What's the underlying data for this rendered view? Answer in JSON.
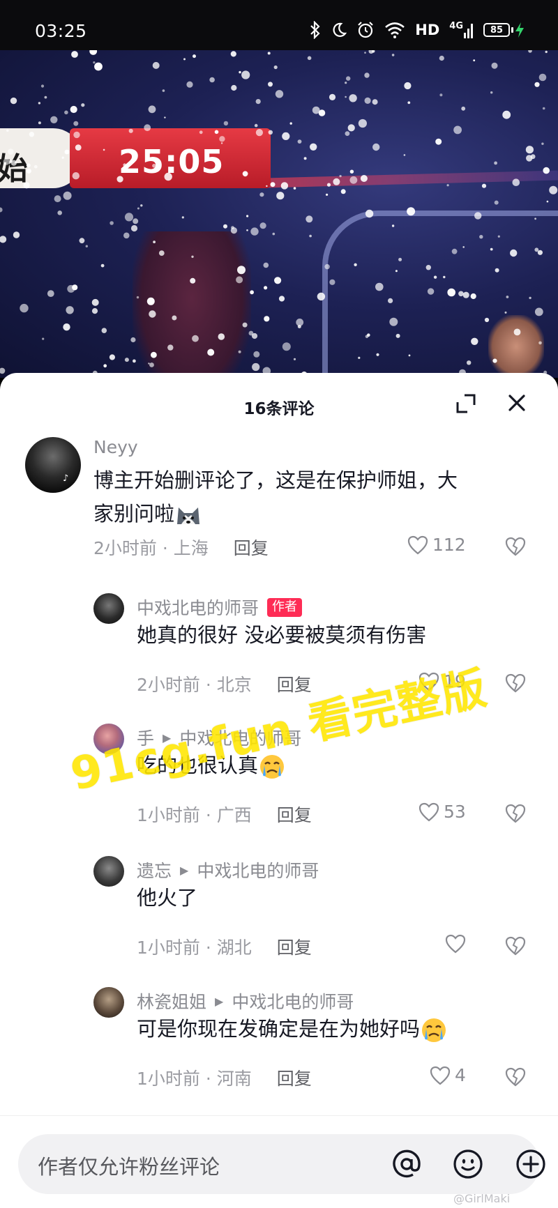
{
  "status_bar": {
    "time": "03:25",
    "hd": "HD",
    "network": "4G",
    "battery": "85",
    "icons": [
      "bluetooth-icon",
      "moon-icon",
      "alarm-icon",
      "wifi-icon",
      "signal-icon",
      "charging-icon"
    ]
  },
  "video": {
    "tag_text": "始",
    "timer": "25:05"
  },
  "sheet": {
    "title": "16条评论",
    "icons": [
      "expand-icon",
      "close-icon"
    ]
  },
  "comments": [
    {
      "user": "Neyy",
      "text": "博主开始删评论了，这是在保护师姐，大\n家别问啦",
      "emoji": "husky-emoji",
      "time": "2小时前 · 上海",
      "reply": "回复",
      "likes": "112"
    },
    {
      "user": "中戏北电的师哥",
      "tag": "作者",
      "text": "她真的很好 没必要被莫须有伤害",
      "time": "2小时前 · 北京",
      "reply": "回复",
      "likes": "19"
    },
    {
      "user": "手",
      "reply_to": "中戏北电的师哥",
      "text": "吃的也很认真",
      "emoji": "crying-emoji",
      "time": "1小时前 · 广西",
      "reply": "回复",
      "likes": "53"
    },
    {
      "user": "遗忘",
      "reply_to": "中戏北电的师哥",
      "text": "他火了",
      "time": "1小时前 · 湖北",
      "reply": "回复",
      "likes": ""
    },
    {
      "user": "林瓷姐姐",
      "reply_to": "中戏北电的师哥",
      "text": "可是你现在发确定是在为她好吗",
      "emoji": "crying-emoji",
      "time": "1小时前 · 河南",
      "reply": "回复",
      "likes": "4"
    }
  ],
  "watermark": "91cg.fun 看完整版",
  "input": {
    "placeholder": "作者仅允许粉丝评论",
    "icons": [
      "at-icon",
      "smile-icon",
      "plus-icon"
    ]
  },
  "credit": "@GirlMaki",
  "colors": {
    "accent": "#fe2c55",
    "watermark": "#ffe600",
    "timer_red": "#d02a36"
  }
}
